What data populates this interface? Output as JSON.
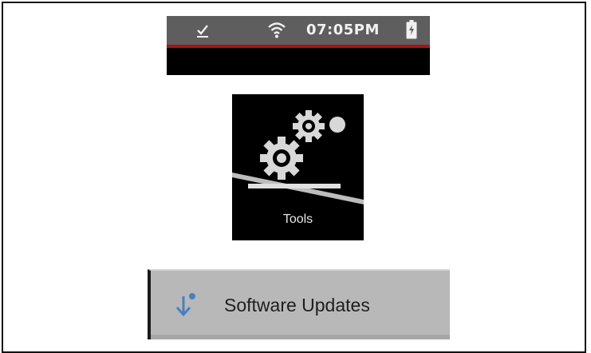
{
  "status_bar": {
    "time": "07:05PM",
    "icons": [
      "check-icon",
      "wifi-icon",
      "battery-charging-icon"
    ],
    "accent_color": "#a8121a"
  },
  "tools_tile": {
    "label": "Tools",
    "icon": "gears-icon"
  },
  "software_updates": {
    "label": "Software Updates",
    "icon": "download-arrow-icon",
    "icon_color": "#4a7fc1"
  }
}
